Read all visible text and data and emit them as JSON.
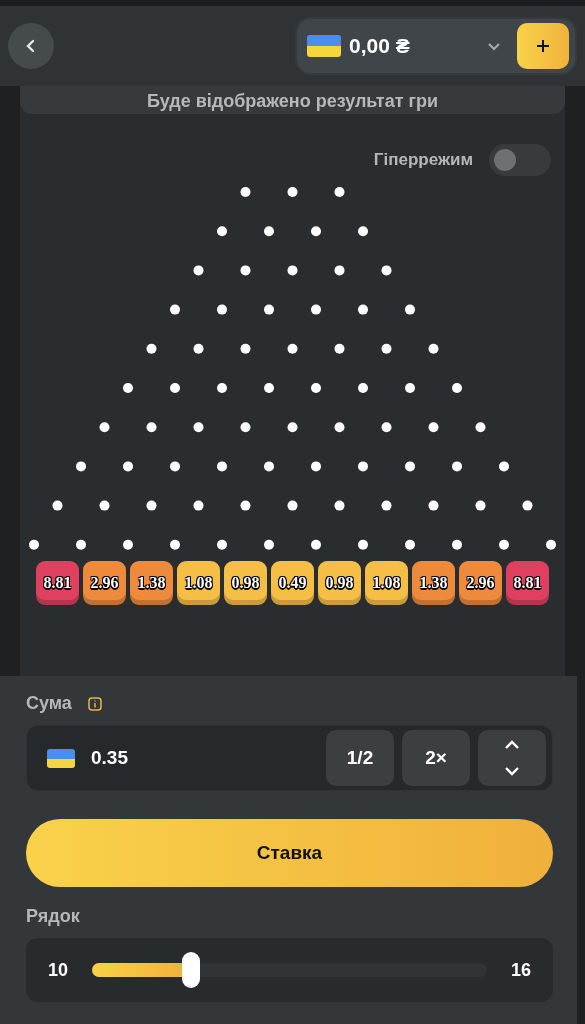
{
  "header": {
    "balance": "0,00 ₴"
  },
  "result_notice": "Буде відображено результат гри",
  "hypermode": {
    "label": "Гіперрежим",
    "on": false
  },
  "multipliers": [
    {
      "label": "8.81",
      "color": "#e0405f"
    },
    {
      "label": "2.96",
      "color": "#ee8a3c"
    },
    {
      "label": "1.38",
      "color": "#ee8a3c"
    },
    {
      "label": "1.08",
      "color": "#f5bf45"
    },
    {
      "label": "0.98",
      "color": "#f5bf45"
    },
    {
      "label": "0.49",
      "color": "#f5bf45"
    },
    {
      "label": "0.98",
      "color": "#f5bf45"
    },
    {
      "label": "1.08",
      "color": "#f5bf45"
    },
    {
      "label": "1.38",
      "color": "#ee8a3c"
    },
    {
      "label": "2.96",
      "color": "#ee8a3c"
    },
    {
      "label": "8.81",
      "color": "#e0405f"
    }
  ],
  "amount": {
    "label": "Сума",
    "value": "0.35",
    "half": "1/2",
    "double": "2×"
  },
  "bet_button": "Ставка",
  "rows": {
    "label": "Рядок",
    "min": "10",
    "max": "16",
    "level": 0.25
  }
}
